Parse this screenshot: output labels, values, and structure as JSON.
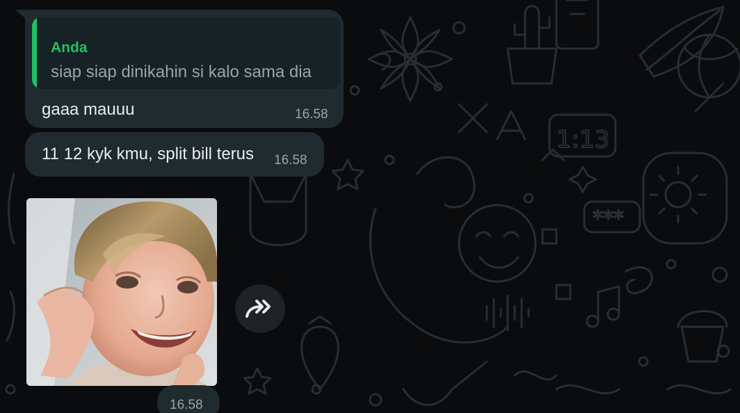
{
  "messages": [
    {
      "quoted": {
        "author": "Anda",
        "text": "siap siap dinikahin si kalo sama dia"
      },
      "text": "gaaa mauuu",
      "time": "16.58"
    },
    {
      "text": "11 12 kyk kmu, split bill terus",
      "time": "16.58"
    },
    {
      "media": "photo of a smiling blond child",
      "time": "16.58"
    }
  ],
  "colors": {
    "background": "#0b0c0d",
    "bubble": "#1f2b2f",
    "quote_bg": "#172226",
    "accent": "#21c063",
    "text": "#e9edef",
    "meta": "#9aa4aa"
  },
  "icons": {
    "forward": "forward-double-arrow-icon"
  }
}
